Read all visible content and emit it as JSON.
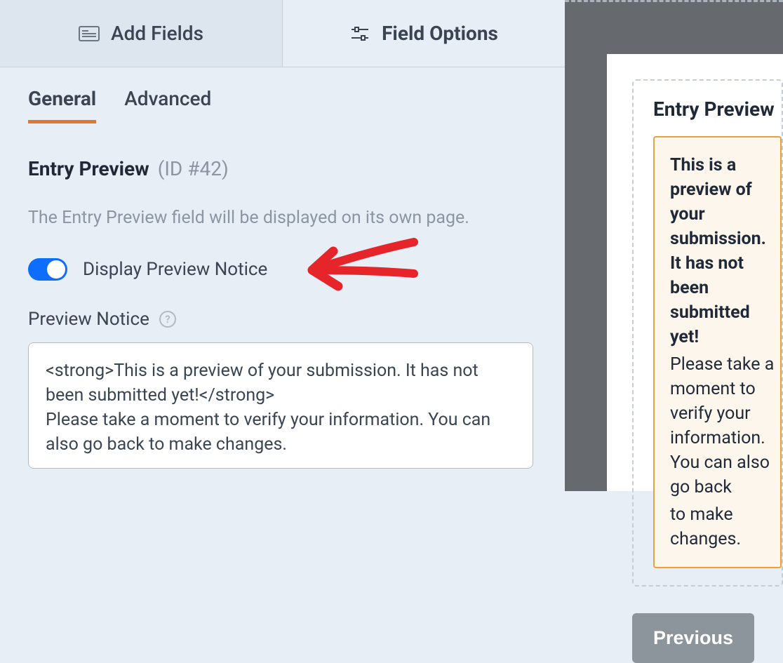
{
  "topTabs": {
    "addFields": "Add Fields",
    "fieldOptions": "Field Options"
  },
  "subTabs": {
    "general": "General",
    "advanced": "Advanced"
  },
  "panel": {
    "heading": "Entry Preview",
    "headingId": "(ID #42)",
    "description": "The Entry Preview field will be displayed on its own page.",
    "toggleLabel": "Display Preview Notice",
    "previewNoticeLabel": "Preview Notice",
    "previewNoticeValue": "<strong>This is a preview of your submission. It has not been submitted yet!</strong>\nPlease take a moment to verify your information. You can also go back to make changes."
  },
  "preview": {
    "title": "Entry Preview",
    "noticeBold": "This is a preview of your submission. It has not been submitted yet!",
    "noticeText1": "Please take a moment to verify your information. You can also go back",
    "noticeText2": "to make changes.",
    "prevButton": "Previous"
  }
}
